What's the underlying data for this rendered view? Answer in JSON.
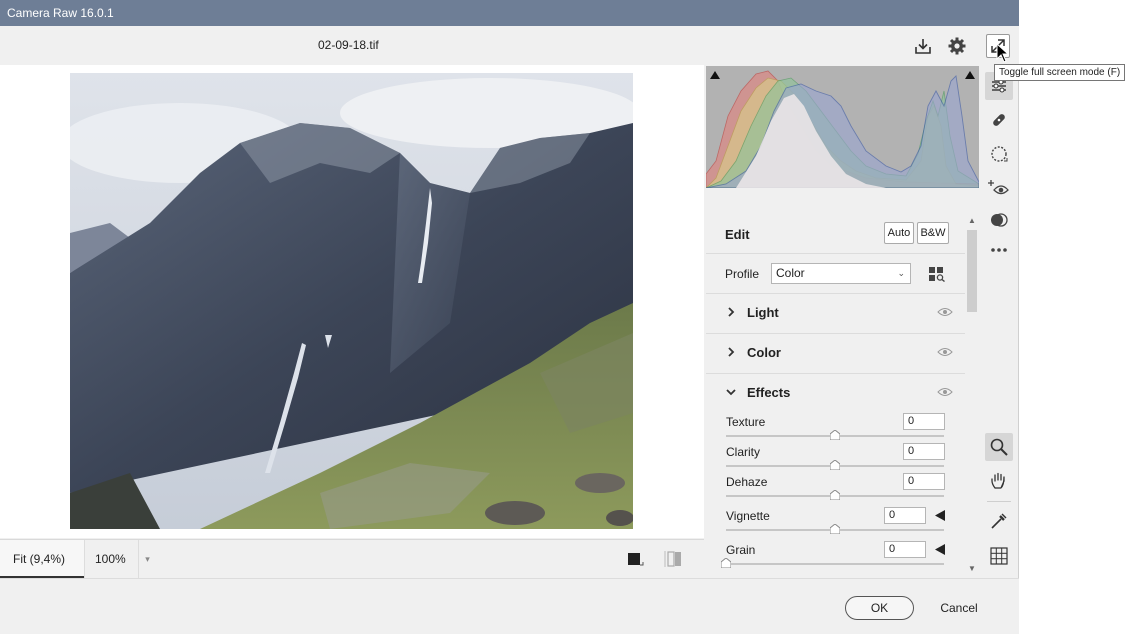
{
  "window": {
    "title": "Camera Raw 16.0.1"
  },
  "header": {
    "filename": "02-09-18.tif",
    "tooltip": "Toggle full screen mode (F)"
  },
  "edit": {
    "title": "Edit",
    "auto_label": "Auto",
    "bw_label": "B&W",
    "profile_label": "Profile",
    "profile_value": "Color",
    "sections": [
      {
        "title": "Light",
        "expanded": false
      },
      {
        "title": "Color",
        "expanded": false
      },
      {
        "title": "Effects",
        "expanded": true
      }
    ],
    "sliders": [
      {
        "label": "Texture",
        "value": "0",
        "position": 0.5
      },
      {
        "label": "Clarity",
        "value": "0",
        "position": 0.5
      },
      {
        "label": "Dehaze",
        "value": "0",
        "position": 0.5
      },
      {
        "label": "Vignette",
        "value": "0",
        "position": 0.5
      },
      {
        "label": "Grain",
        "value": "0",
        "position": 0.0
      }
    ]
  },
  "zoom": {
    "fit_label": "Fit (9,4%)",
    "percent_label": "100%"
  },
  "footer": {
    "ok_label": "OK",
    "cancel_label": "Cancel"
  },
  "icons": {
    "save": "save-icon",
    "settings": "gear-icon",
    "fullscreen": "fullscreen-icon",
    "edit": "sliders-icon",
    "heal": "bandage-icon",
    "mask": "mask-icon",
    "redeye": "red-eye-icon",
    "presets": "presets-icon",
    "more": "more-icon",
    "zoom": "zoom-icon",
    "hand": "hand-icon",
    "sampler": "color-sampler-icon",
    "grid": "grid-icon"
  },
  "colors": {
    "titlebar": "#6e7e96",
    "histogram_bg": "#b2b2b2",
    "panel_bg": "#f0f0f0"
  }
}
